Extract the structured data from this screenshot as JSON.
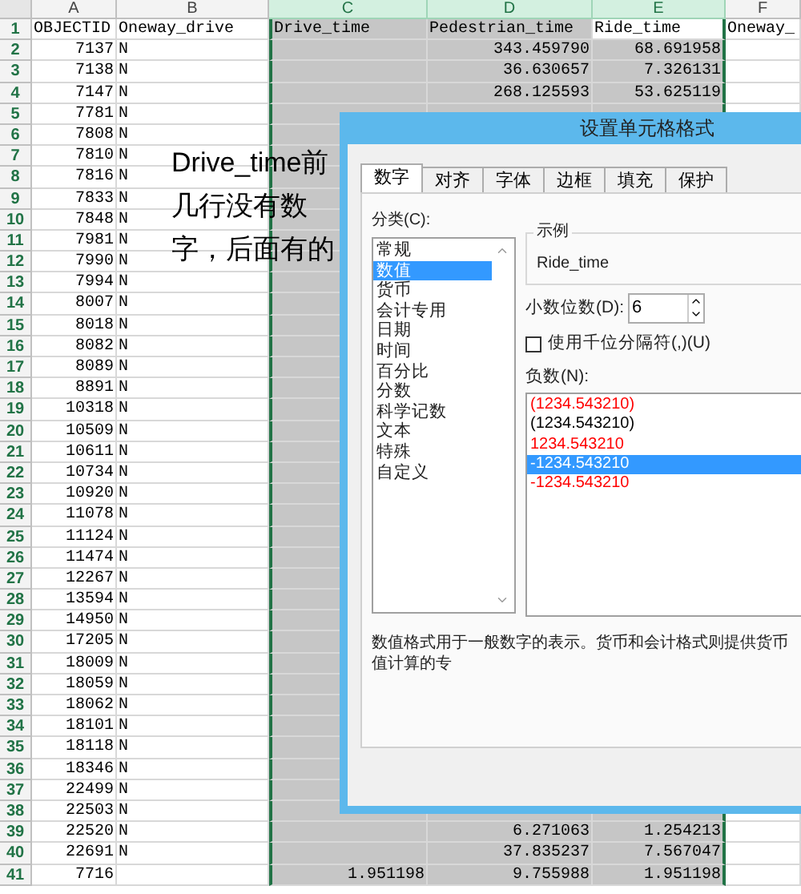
{
  "columns": [
    {
      "label": "A",
      "selected": false,
      "active": false
    },
    {
      "label": "B",
      "selected": false,
      "active": false
    },
    {
      "label": "C",
      "selected": true,
      "active": false
    },
    {
      "label": "D",
      "selected": true,
      "active": false
    },
    {
      "label": "E",
      "selected": true,
      "active": true
    },
    {
      "label": "F",
      "selected": false,
      "active": false
    }
  ],
  "rows": [
    {
      "number": "1",
      "a": "OBJECTID",
      "b": "Oneway_drive",
      "c": "Drive_time",
      "d": "Pedestrian_time",
      "e": "Ride_time",
      "f": "Oneway_"
    },
    {
      "number": "2",
      "a": "7137",
      "b": "N",
      "d": "343.459790",
      "e": "68.691958"
    },
    {
      "number": "3",
      "a": "7138",
      "b": "N",
      "d": "36.630657",
      "e": "7.326131"
    },
    {
      "number": "4",
      "a": "7147",
      "b": "N",
      "d": "268.125593",
      "e": "53.625119"
    },
    {
      "number": "5",
      "a": "7781",
      "b": "N"
    },
    {
      "number": "6",
      "a": "7808",
      "b": "N"
    },
    {
      "number": "7",
      "a": "7810",
      "b": "N"
    },
    {
      "number": "8",
      "a": "7816",
      "b": "N"
    },
    {
      "number": "9",
      "a": "7833",
      "b": "N"
    },
    {
      "number": "10",
      "a": "7848",
      "b": "N"
    },
    {
      "number": "11",
      "a": "7981",
      "b": "N"
    },
    {
      "number": "12",
      "a": "7990",
      "b": "N"
    },
    {
      "number": "13",
      "a": "7994",
      "b": "N"
    },
    {
      "number": "14",
      "a": "8007",
      "b": "N"
    },
    {
      "number": "15",
      "a": "8018",
      "b": "N"
    },
    {
      "number": "16",
      "a": "8082",
      "b": "N"
    },
    {
      "number": "17",
      "a": "8089",
      "b": "N"
    },
    {
      "number": "18",
      "a": "8891",
      "b": "N"
    },
    {
      "number": "19",
      "a": "10318",
      "b": "N"
    },
    {
      "number": "20",
      "a": "10509",
      "b": "N"
    },
    {
      "number": "21",
      "a": "10611",
      "b": "N"
    },
    {
      "number": "22",
      "a": "10734",
      "b": "N"
    },
    {
      "number": "23",
      "a": "10920",
      "b": "N"
    },
    {
      "number": "24",
      "a": "11078",
      "b": "N"
    },
    {
      "number": "25",
      "a": "11124",
      "b": "N"
    },
    {
      "number": "26",
      "a": "11474",
      "b": "N"
    },
    {
      "number": "27",
      "a": "12267",
      "b": "N"
    },
    {
      "number": "28",
      "a": "13594",
      "b": "N"
    },
    {
      "number": "29",
      "a": "14950",
      "b": "N"
    },
    {
      "number": "30",
      "a": "17205",
      "b": "N"
    },
    {
      "number": "31",
      "a": "18009",
      "b": "N"
    },
    {
      "number": "32",
      "a": "18059",
      "b": "N"
    },
    {
      "number": "33",
      "a": "18062",
      "b": "N"
    },
    {
      "number": "34",
      "a": "18101",
      "b": "N"
    },
    {
      "number": "35",
      "a": "18118",
      "b": "N"
    },
    {
      "number": "36",
      "a": "18346",
      "b": "N"
    },
    {
      "number": "37",
      "a": "22499",
      "b": "N"
    },
    {
      "number": "38",
      "a": "22503",
      "b": "N"
    },
    {
      "number": "39",
      "a": "22520",
      "b": "N",
      "d": "6.271063",
      "e": "1.254213"
    },
    {
      "number": "40",
      "a": "22691",
      "b": "N",
      "d": "37.835237",
      "e": "7.567047"
    },
    {
      "number": "41",
      "a": "7716",
      "c": "1.951198",
      "d": "9.755988",
      "e": "1.951198"
    }
  ],
  "annotation": [
    "Drive_time前",
    "几行没有数",
    "字，后面有的"
  ],
  "dialog": {
    "title": "设置单元格格式",
    "tabs": [
      {
        "label": "数字",
        "selected": true
      },
      {
        "label": "对齐",
        "selected": false
      },
      {
        "label": "字体",
        "selected": false
      },
      {
        "label": "边框",
        "selected": false
      },
      {
        "label": "填充",
        "selected": false
      },
      {
        "label": "保护",
        "selected": false
      }
    ],
    "category_label": "分类(C):",
    "categories": [
      {
        "label": "常规",
        "selected": false
      },
      {
        "label": "数值",
        "selected": true
      },
      {
        "label": "货币",
        "selected": false
      },
      {
        "label": "会计专用",
        "selected": false
      },
      {
        "label": "日期",
        "selected": false
      },
      {
        "label": "时间",
        "selected": false
      },
      {
        "label": "百分比",
        "selected": false
      },
      {
        "label": "分数",
        "selected": false
      },
      {
        "label": "科学记数",
        "selected": false
      },
      {
        "label": "文本",
        "selected": false
      },
      {
        "label": "特殊",
        "selected": false
      },
      {
        "label": "自定义",
        "selected": false
      }
    ],
    "sample": {
      "label": "示例",
      "value": "Ride_time"
    },
    "decimal_places": {
      "label": "小数位数(D):",
      "value": "6"
    },
    "thousands_separator": {
      "label": "使用千位分隔符(,)(U)",
      "checked": false
    },
    "negative_label": "负数(N):",
    "negative_formats": [
      {
        "label": "(1234.543210)",
        "color": "#ff0000",
        "selected": false
      },
      {
        "label": "(1234.543210)",
        "color": "#000000",
        "selected": false
      },
      {
        "label": "1234.543210",
        "color": "#ff0000",
        "selected": false
      },
      {
        "label": "-1234.543210",
        "selected": true
      },
      {
        "label": "-1234.543210",
        "color": "#ff0000",
        "selected": false
      }
    ],
    "description": "数值格式用于一般数字的表示。货币和会计格式则提供货币值计算的专"
  }
}
